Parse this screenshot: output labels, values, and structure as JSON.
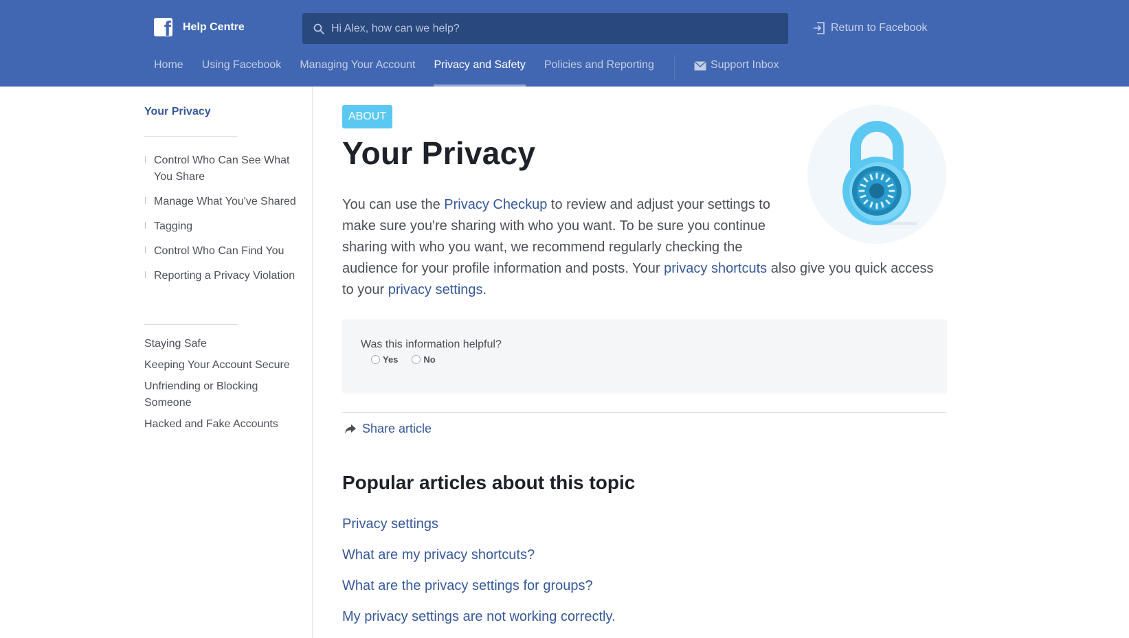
{
  "header": {
    "brand": "Help Centre",
    "search_placeholder": "Hi Alex, how can we help?",
    "return_link": "Return to Facebook",
    "nav": [
      "Home",
      "Using Facebook",
      "Managing Your Account",
      "Privacy and Safety",
      "Policies and Reporting"
    ],
    "active_nav": "Privacy and Safety",
    "support_inbox": "Support Inbox"
  },
  "sidebar": {
    "title": "Your Privacy",
    "sub_items": [
      "Control Who Can See What You Share",
      "Manage What You've Shared",
      "Tagging",
      "Control Who Can Find You",
      "Reporting a Privacy Violation"
    ],
    "items": [
      "Staying Safe",
      "Keeping Your Account Secure",
      "Unfriending or Blocking Someone",
      "Hacked and Fake Accounts"
    ]
  },
  "article": {
    "badge": "ABOUT",
    "title": "Your Privacy",
    "intro": {
      "t1": "You can use the ",
      "link1": "Privacy Checkup",
      "t2": " to review and adjust your settings to make sure you're sharing with who you want. To be sure you continue sharing with who you want, we recommend regularly checking the audience for your profile information and posts. Your ",
      "link2": "privacy shortcuts",
      "t3": " also give you quick access to your ",
      "link3": "privacy settings",
      "t4": "."
    },
    "feedback": {
      "question": "Was this information helpful?",
      "yes": "Yes",
      "no": "No"
    },
    "share": "Share article",
    "popular_title": "Popular articles about this topic",
    "popular": [
      "Privacy settings",
      "What are my privacy shortcuts?",
      "What are the privacy settings for groups?",
      "My privacy settings are not working correctly."
    ]
  },
  "colors": {
    "header_bg": "#4267b2",
    "search_bg": "#29487d",
    "link": "#365899",
    "badge": "#5bc8f2",
    "feedback_bg": "#f5f6f7"
  },
  "icons": [
    "facebook-logo-icon",
    "search-icon",
    "return-icon",
    "envelope-icon",
    "share-arrow-icon",
    "lock-illustration"
  ]
}
